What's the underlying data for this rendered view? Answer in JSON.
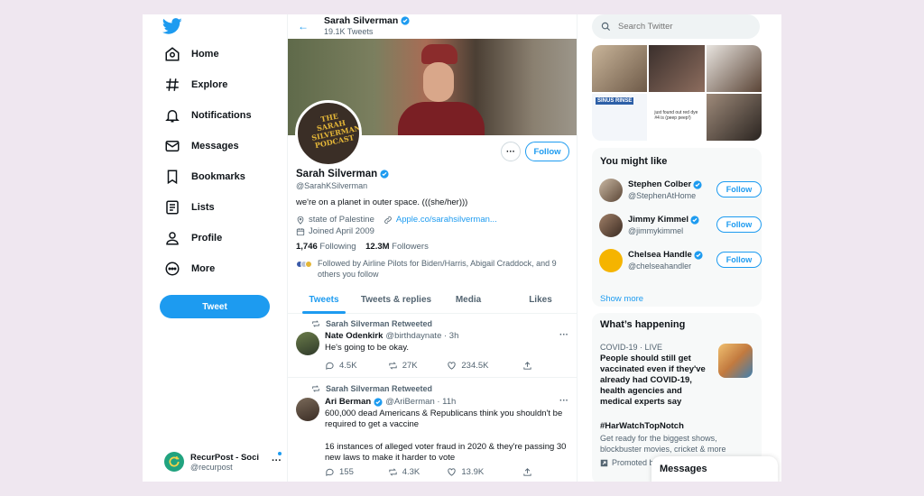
{
  "nav": {
    "items": [
      {
        "label": "Home",
        "icon": "home-icon"
      },
      {
        "label": "Explore",
        "icon": "hashtag-icon"
      },
      {
        "label": "Notifications",
        "icon": "bell-icon"
      },
      {
        "label": "Messages",
        "icon": "envelope-icon"
      },
      {
        "label": "Bookmarks",
        "icon": "bookmark-icon"
      },
      {
        "label": "Lists",
        "icon": "list-icon"
      },
      {
        "label": "Profile",
        "icon": "person-icon"
      },
      {
        "label": "More",
        "icon": "more-circle-icon"
      }
    ],
    "tweet_button": "Tweet",
    "account": {
      "name": "RecurPost - Soci",
      "handle": "@recurpost"
    }
  },
  "header": {
    "name": "Sarah Silverman",
    "tweet_count": "19.1K Tweets"
  },
  "profile": {
    "avatar_text": "THE SARAH SILVERMAN PODCAST",
    "follow_label": "Follow",
    "name": "Sarah Silverman",
    "handle": "@SarahKSilverman",
    "bio": "we're on a planet in outer space. (((she/her)))",
    "location": "state of Palestine",
    "link": "Apple.co/sarahsilverman...",
    "joined": "Joined April 2009",
    "following_count": "1,746",
    "following_label": "Following",
    "followers_count": "12.3M",
    "followers_label": "Followers",
    "followed_by": "Followed by Airline Pilots for Biden/Harris, Abigail Craddock, and 9 others you follow"
  },
  "tabs": [
    "Tweets",
    "Tweets & replies",
    "Media",
    "Likes"
  ],
  "tweets": [
    {
      "retweeted_by": "Sarah Silverman Retweeted",
      "name": "Nate Odenkirk",
      "handle": "@birthdaynate · 3h",
      "text": "He's going to be okay.",
      "replies": "4.5K",
      "retweets": "27K",
      "likes": "234.5K"
    },
    {
      "retweeted_by": "Sarah Silverman Retweeted",
      "name": "Ari Berman",
      "handle": "@AriBerman · 11h",
      "text1": "600,000 dead Americans & Republicans think you shouldn't be required to get a vaccine",
      "text2": "16 instances of alleged voter fraud in 2020 & they're passing 30 new laws to make it harder to vote",
      "replies": "155",
      "retweets": "4.3K",
      "likes": "13.9K"
    }
  ],
  "search": {
    "placeholder": "Search Twitter"
  },
  "media_grid": {
    "sign_text": "SINUS RINSE",
    "caption": "just found out red dye #4 is (peep peep!)"
  },
  "who_to_follow": {
    "title": "You might like",
    "users": [
      {
        "name": "Stephen Colber",
        "handle": "@StephenAtHome",
        "button": "Follow"
      },
      {
        "name": "Jimmy Kimmel",
        "handle": "@jimmykimmel",
        "button": "Follow"
      },
      {
        "name": "Chelsea Handle",
        "handle": "@chelseahandler",
        "button": "Follow"
      }
    ],
    "show_more": "Show more"
  },
  "trends": {
    "title": "What’s happening",
    "items": [
      {
        "label": "COVID-19 · LIVE",
        "title": "People should still get vaccinated even if they've already had COVID-19, health agencies and medical experts say"
      },
      {
        "title": "#HarWatchTopNotch",
        "desc": "Get ready for the biggest shows, blockbuster movies, cricket & more",
        "promoted": "Promoted by"
      }
    ]
  },
  "messages_bar": "Messages",
  "colors": {
    "accent": "#1d9bf0",
    "text": "#0f1419",
    "muted": "#536471",
    "background": "#efe7f0"
  }
}
